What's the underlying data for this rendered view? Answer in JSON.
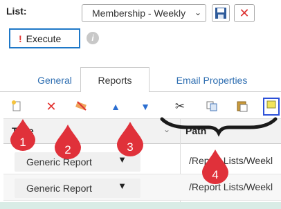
{
  "header": {
    "list_label": "List:",
    "list_value": "Membership - Weekly"
  },
  "execute": {
    "label": "Execute"
  },
  "tabs": [
    {
      "label": "General"
    },
    {
      "label": "Reports"
    },
    {
      "label": "Email Properties"
    }
  ],
  "toolbar": {
    "icons": [
      "new-report-icon",
      "delete-icon",
      "clear-icon",
      "move-up-icon",
      "move-down-icon",
      "cut-icon",
      "copy-icon",
      "paste-icon",
      "options-icon"
    ]
  },
  "grid": {
    "columns": [
      "Type",
      "Path"
    ],
    "rows": [
      {
        "type": "Generic Report",
        "path": "/Report Lists/Weekl"
      },
      {
        "type": "Generic Report",
        "path": "/Report Lists/Weekl"
      }
    ]
  },
  "markers": [
    "1",
    "2",
    "3",
    "4"
  ],
  "colors": {
    "marker": "#e0313a",
    "accent": "#1e78c8",
    "tab_text": "#2b6cb0"
  }
}
